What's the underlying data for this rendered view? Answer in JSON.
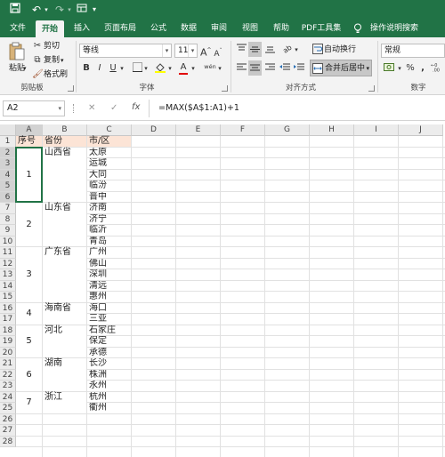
{
  "quick_access": {
    "save_icon": "save-icon",
    "undo_icon": "undo-icon",
    "redo_icon": "redo-icon",
    "customize_icon": "customize-icon"
  },
  "tabs": [
    "文件",
    "开始",
    "插入",
    "页面布局",
    "公式",
    "数据",
    "审阅",
    "视图",
    "帮助",
    "PDF工具集",
    "操作说明搜索"
  ],
  "active_tab": "开始",
  "ribbon": {
    "clipboard": {
      "paste": "粘贴",
      "cut": "剪切",
      "copy": "复制",
      "format_painter": "格式刷",
      "group": "剪贴板"
    },
    "font": {
      "name": "等线",
      "size": "11",
      "grow": "A",
      "shrink": "A",
      "bold": "B",
      "italic": "I",
      "underline": "U",
      "color_a": "A",
      "wen": "wén",
      "group": "字体"
    },
    "alignment": {
      "wrap": "自动换行",
      "merge": "合并后居中",
      "group": "对齐方式"
    },
    "number": {
      "format": "常规",
      "percent": "%",
      "comma": ",",
      "group": "数字"
    }
  },
  "formula_bar": {
    "name_box": "A2",
    "cancel": "✕",
    "enter": "✓",
    "fx": "fx",
    "formula": "=MAX($A$1:A1)+1"
  },
  "columns": [
    "A",
    "B",
    "C",
    "D",
    "E",
    "F",
    "G",
    "H",
    "I",
    "J"
  ],
  "rows": [
    "1",
    "2",
    "3",
    "4",
    "5",
    "6",
    "7",
    "8",
    "9",
    "10",
    "11",
    "12",
    "13",
    "14",
    "15",
    "16",
    "17",
    "18",
    "19",
    "20",
    "21",
    "22",
    "23",
    "24",
    "25",
    "26",
    "27",
    "28"
  ],
  "header_row": {
    "a": "序号",
    "b": "省份",
    "c": "市/区"
  },
  "groups": [
    {
      "number": "1",
      "province": "山西省",
      "cities": [
        "太原",
        "运城",
        "大同",
        "临汾",
        "晋中"
      ]
    },
    {
      "number": "2",
      "province": "山东省",
      "cities": [
        "济南",
        "济宁",
        "临沂",
        "青岛"
      ]
    },
    {
      "number": "3",
      "province": "广东省",
      "cities": [
        "广州",
        "佛山",
        "深圳",
        "清远",
        "惠州"
      ]
    },
    {
      "number": "4",
      "province": "海南省",
      "cities": [
        "海口",
        "三亚"
      ]
    },
    {
      "number": "5",
      "province": "河北",
      "cities": [
        "石家庄",
        "保定",
        "承德"
      ]
    },
    {
      "number": "6",
      "province": "湖南",
      "cities": [
        "长沙",
        "株洲",
        "永州"
      ]
    },
    {
      "number": "7",
      "province": "浙江",
      "cities": [
        "杭州",
        "衢州"
      ]
    }
  ],
  "colors": {
    "accent": "#217346",
    "header_fill": "#fce4d6"
  }
}
